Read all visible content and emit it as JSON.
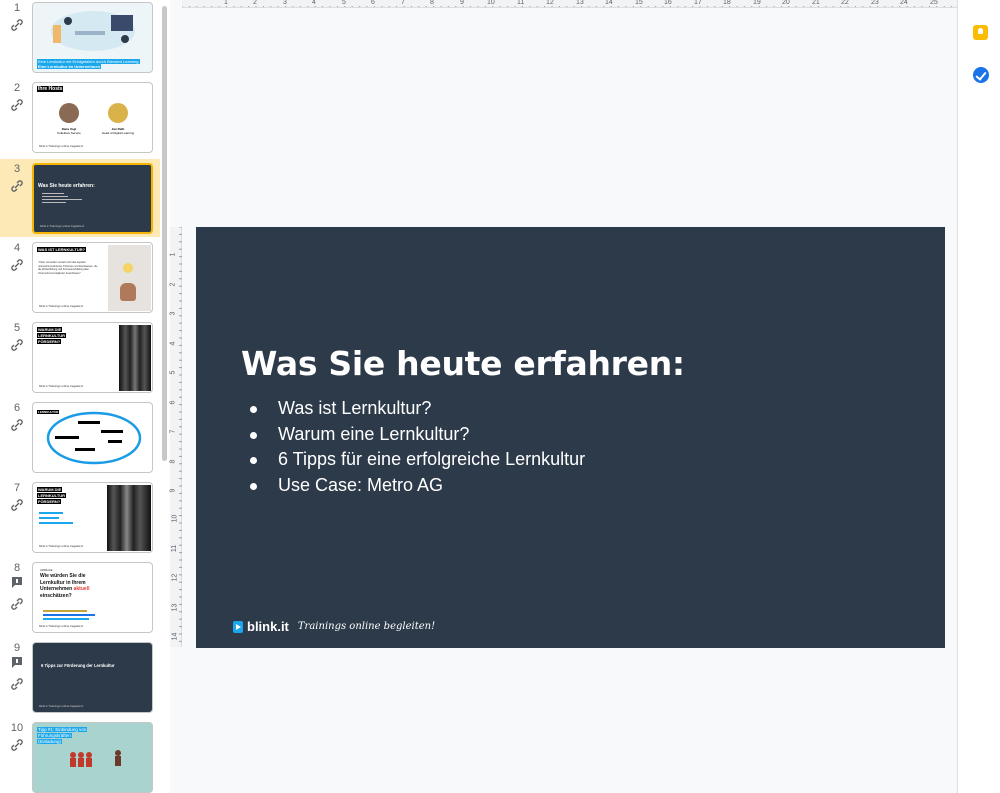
{
  "filmstrip": {
    "slides": [
      {
        "number": "1",
        "caption_line1": "Eine Lernkultur mit Erfolgsfaktor durch Blended Learning",
        "caption_line2": "Eine Lernkultur im Unternehmen"
      },
      {
        "number": "2",
        "title": "Ihre Hosts",
        "host1_name": "Dana Vogt",
        "host1_role": "Kollektive Service",
        "host2_name": "Jan Rath",
        "host2_role": "Head of Digital Learning"
      },
      {
        "number": "3",
        "title": "Was Sie heute erfahren:"
      },
      {
        "number": "4",
        "title": "WAS IST LERNKULTUR?",
        "body": "\"Unter Lernkultur versteht sich alle Aspekte unternehmensinterner Prozesse und Denkweisen, die die Weiterbildung und Kompetenzbildung aller Unternehmensmitglieder beeinflussen\""
      },
      {
        "number": "5",
        "title_line1": "WARUM DIE",
        "title_line2": "LERNKULTUR",
        "title_line3": "FÖRDERN?"
      },
      {
        "number": "6",
        "title": "LERNKULTUR"
      },
      {
        "number": "7",
        "title_line1": "WARUM DIE",
        "title_line2": "LERNKULTUR",
        "title_line3": "FÖRDERN?"
      },
      {
        "number": "8",
        "kicker": "UMFRAGE",
        "title_line1": "Wie würden Sie die",
        "title_line2": "Lernkultur in Ihrem",
        "title_line3": "Unternehmen",
        "title_accent": "aktuell",
        "title_line4": "einschätzen?"
      },
      {
        "number": "9",
        "title": "6 Tipps zur Förderung der Lernkultur"
      },
      {
        "number": "10",
        "title_line1": "Tipp #1: Einbindung von",
        "title_line2": "Führungskräften",
        "title_line3": "(Einladung)"
      }
    ],
    "thumb_footer": "blink.it  Trainings online begleiten!"
  },
  "rulers": {
    "horizontal": [
      "1",
      "2",
      "3",
      "4",
      "5",
      "6",
      "7",
      "8",
      "9",
      "10",
      "11",
      "12",
      "13",
      "14",
      "15",
      "16",
      "17",
      "18",
      "19",
      "20",
      "21",
      "22",
      "23",
      "24",
      "25"
    ],
    "vertical": [
      "1",
      "2",
      "3",
      "4",
      "5",
      "6",
      "7",
      "8",
      "9",
      "10",
      "11",
      "12",
      "13",
      "14"
    ]
  },
  "slide": {
    "title": "Was Sie heute erfahren:",
    "bullets": [
      "Was ist Lernkultur?",
      "Warum eine Lernkultur?",
      "6 Tipps für eine erfolgreiche Lernkultur",
      "Use Case: Metro AG"
    ],
    "brand_name": "blink.it",
    "brand_tagline": "Trainings online begleiten!",
    "background_color": "#2d3a4a"
  },
  "side_panel": {
    "icons": [
      "keep-icon",
      "tasks-icon"
    ]
  }
}
